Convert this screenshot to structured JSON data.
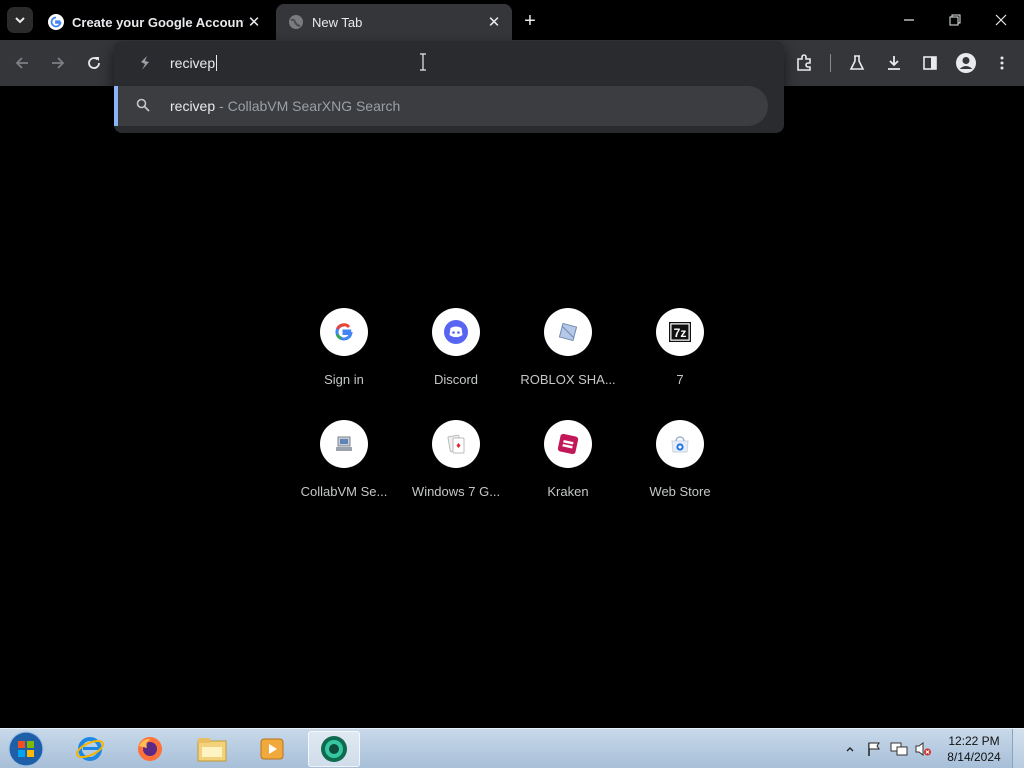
{
  "tabs": [
    {
      "title": "Create your Google Account",
      "favicon": "google-g-icon"
    },
    {
      "title": "New Tab",
      "favicon": "globe-icon"
    }
  ],
  "omnibox": {
    "value": "recivep",
    "suggestion": {
      "query": "recivep",
      "separator": "-",
      "provider": "CollabVM SearXNG Search"
    }
  },
  "shortcuts": [
    {
      "label": "Sign in",
      "icon": "google-g-icon"
    },
    {
      "label": "Discord",
      "icon": "discord-icon"
    },
    {
      "label": "ROBLOX SHA...",
      "icon": "roblox-icon"
    },
    {
      "label": "7",
      "icon": "7zip-icon"
    },
    {
      "label": "CollabVM Se...",
      "icon": "collabvm-icon"
    },
    {
      "label": "Windows 7 G...",
      "icon": "cards-icon"
    },
    {
      "label": "Kraken",
      "icon": "kraken-icon"
    },
    {
      "label": "Web Store",
      "icon": "webstore-icon"
    }
  ],
  "taskbar": {
    "apps": [
      "internet-explorer-icon",
      "firefox-icon",
      "file-explorer-icon",
      "media-player-icon",
      "chrome-canary-icon"
    ],
    "clock": {
      "time": "12:22 PM",
      "date": "8/14/2024"
    }
  },
  "colors": {
    "accent": "#8ab4f8",
    "toolbar": "#35363a",
    "tab_strip": "#000000"
  }
}
